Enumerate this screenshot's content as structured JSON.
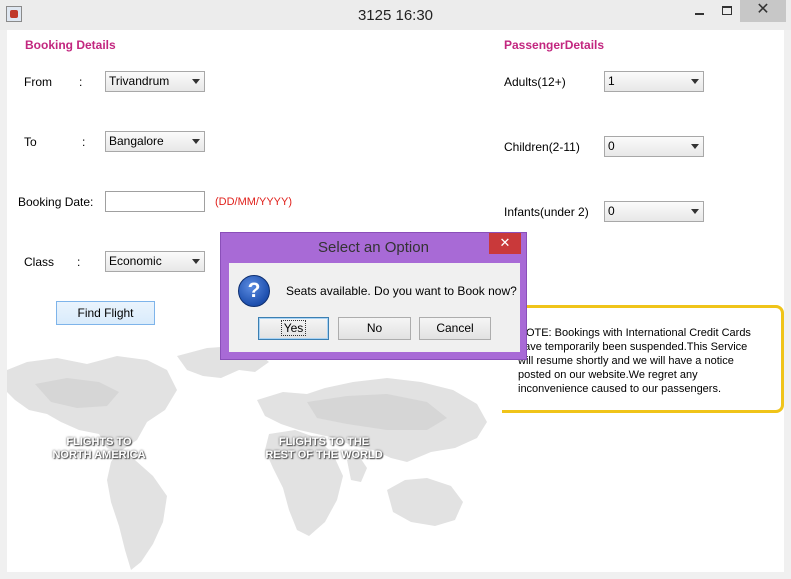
{
  "window": {
    "title": "3125 16:30",
    "close_glyph": "✕"
  },
  "booking": {
    "heading": "Booking Details",
    "from_label": "From",
    "from_value": "Trivandrum",
    "to_label": "To",
    "to_value": "Bangalore",
    "date_label": "Booking Date:",
    "date_value": "",
    "date_hint": "(DD/MM/YYYY)",
    "class_label": "Class",
    "class_value": "Economic",
    "colon": ":",
    "find_button": "Find Flight"
  },
  "passenger": {
    "heading": "PassengerDetails",
    "adults_label": "Adults(12+)",
    "adults_value": "1",
    "children_label": "Children(2-11)",
    "children_value": "0",
    "infants_label": "Infants(under 2)",
    "infants_value": "0"
  },
  "map": {
    "north_america_line1": "FLIGHTS TO",
    "north_america_line2": "NORTH AMERICA",
    "rest_line1": "FLIGHTS TO THE",
    "rest_line2": "REST OF THE WORLD"
  },
  "notice": {
    "line1": "NOTE: Bookings with International Credit Cards",
    "line2": "have temporarily been suspended.This Service",
    "line3": "will resume shortly and we will have a notice",
    "line4": "posted on our website.We regret any",
    "line5": "inconvenience caused to our passengers."
  },
  "dialog": {
    "title": "Select an Option",
    "close_glyph": "✕",
    "icon_glyph": "?",
    "message": "Seats available. Do you want to Book now?",
    "yes": "Yes",
    "no": "No",
    "cancel": "Cancel"
  },
  "colors": {
    "heading": "#c2267f",
    "date_hint": "#e0201b",
    "dialog_frame": "#a86ad6",
    "dialog_close": "#c9393a",
    "notice_border": "#f0c419"
  }
}
